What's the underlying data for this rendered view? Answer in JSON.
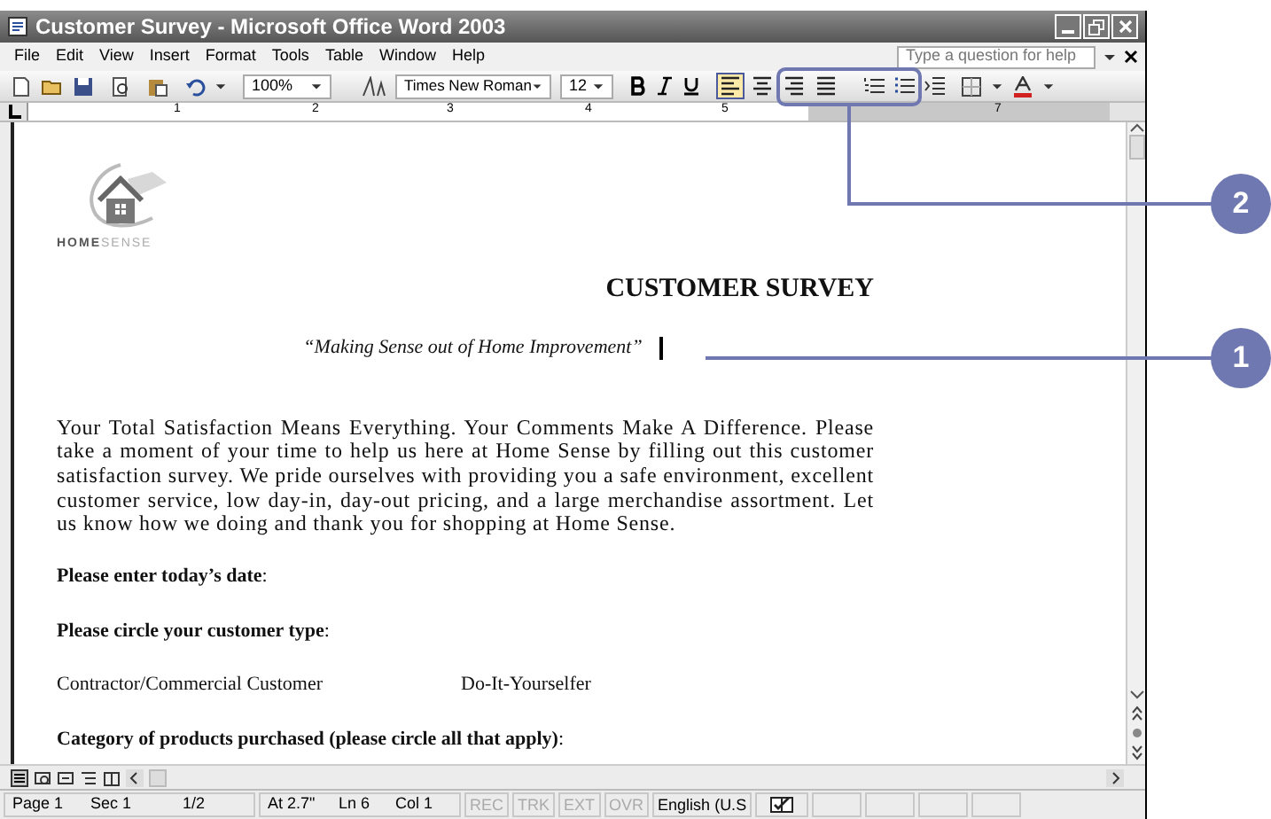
{
  "window": {
    "title": "Customer Survey - Microsoft Office Word 2003"
  },
  "menu": [
    "File",
    "Edit",
    "View",
    "Insert",
    "Format",
    "Tools",
    "Table",
    "Window",
    "Help"
  ],
  "help_box": {
    "placeholder": "Type a question for help"
  },
  "toolbar": {
    "zoom": "100%",
    "font": "Times New Roman",
    "size": "12",
    "alignment": [
      {
        "kind": "left",
        "selected": true
      },
      {
        "kind": "center",
        "selected": false
      },
      {
        "kind": "right",
        "selected": false
      },
      {
        "kind": "justify",
        "selected": false
      }
    ]
  },
  "ruler": [
    "1",
    "2",
    "3",
    "4",
    "5",
    "7"
  ],
  "document": {
    "logo": {
      "first": "HOME",
      "second": "SENSE"
    },
    "heading": "CUSTOMER SURVEY",
    "tagline": "“Making Sense out of Home Improvement”",
    "paragraph": "Your Total Satisfaction Means Everything. Your Comments Make A Difference. Please take a moment of your time to help us here at Home Sense by filling out this customer satisfaction survey. We pride ourselves with providing you a safe environment, excellent customer service, low day-in, day-out pricing, and a large merchandise assortment. Let us know how we doing and thank you for shopping at Home Sense.",
    "questions": [
      {
        "kind": "question",
        "text": "**Please enter today’s date**:"
      },
      {
        "kind": "question",
        "text": "**Please circle your customer type**:"
      },
      {
        "kind": "options",
        "options": [
          "Contractor/Commercial Customer",
          "Do-It-Yourselfer"
        ]
      },
      {
        "kind": "question",
        "text": "**Category of products purchased (please circle all that apply)**:"
      }
    ]
  },
  "status_bar": {
    "groups": [
      [
        "Page 1",
        "Sec 1",
        "1/2"
      ],
      [
        "At 2.7\"",
        "Ln 6",
        "Col 1"
      ]
    ],
    "modes": [
      {
        "label": "REC",
        "active": false
      },
      {
        "label": "TRK",
        "active": false
      },
      {
        "label": "EXT",
        "active": false
      },
      {
        "label": "OVR",
        "active": false
      }
    ],
    "language": "English (U.S"
  },
  "callouts": [
    "2",
    "1"
  ]
}
